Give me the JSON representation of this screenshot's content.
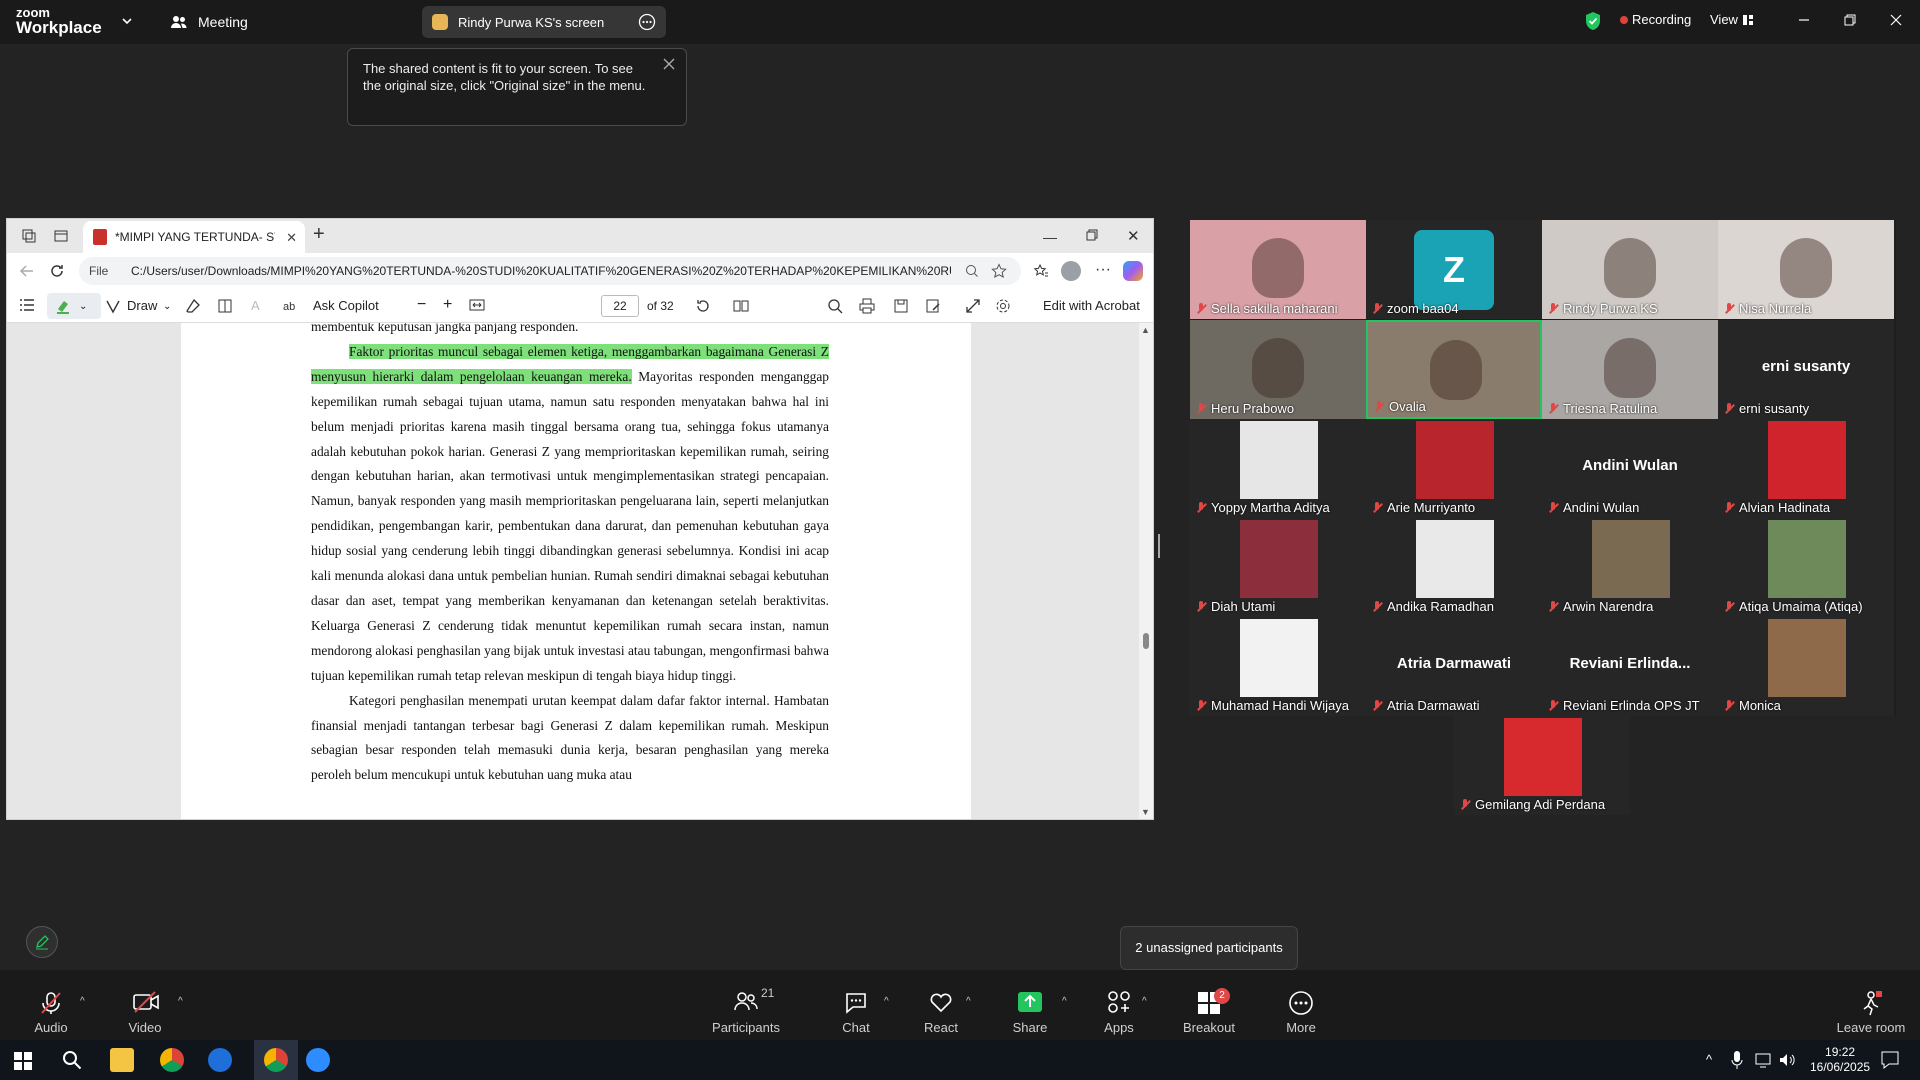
{
  "topbar": {
    "brand_line1": "zoom",
    "brand_line2": "Workplace",
    "meeting_label": "Meeting",
    "share_pill_label": "Rindy Purwa KS's screen",
    "recording_label": "Recording",
    "view_label": "View"
  },
  "tooltip": {
    "text": "The shared content is fit to your screen. To see the original size, click \"Original size\" in the menu."
  },
  "browser": {
    "tab_title": "*MIMPI YANG TERTUNDA- STUDI",
    "file_label": "File",
    "url": "C:/Users/user/Downloads/MIMPI%20YANG%20TERTUNDA-%20STUDI%20KUALITATIF%20GENERASI%20Z%20TERHADAP%20KEPEMILIKAN%20RU...",
    "draw_label": "Draw",
    "ask_copilot_label": "Ask Copilot",
    "page_current": "22",
    "page_total": "of 32",
    "edit_acrobat_label": "Edit with Acrobat"
  },
  "document": {
    "line0": "membentuk keputusan jangka panjang responden.",
    "p1_highlight": "Faktor prioritas muncul sebagai elemen ketiga, menggambarkan bagaimana Generasi Z menyusun hierarki dalam pengelolaan keuangan mereka.",
    "p1_rest": " Mayoritas responden menganggap kepemilikan rumah sebagai tujuan utama, namun satu responden menyatakan bahwa hal ini belum menjadi prioritas karena masih tinggal bersama orang tua, sehingga fokus utamanya adalah kebutuhan pokok harian. Generasi Z yang memprioritaskan kepemilikan rumah, seiring dengan kebutuhan harian, akan termotivasi untuk mengimplementasikan strategi pencapaian. Namun, banyak responden yang masih memprioritaskan pengeluarana lain, seperti melanjutkan pendidikan, pengembangan karir, pembentukan dana darurat, dan pemenuhan kebutuhan gaya hidup sosial yang cenderung lebih tinggi dibandingkan generasi sebelumnya. Kondisi ini acap kali menunda alokasi dana untuk pembelian hunian. Rumah sendiri dimaknai sebagai kebutuhan dasar dan aset, tempat yang memberikan kenyamanan dan ketenangan setelah beraktivitas. Keluarga Generasi Z cenderung tidak menuntut kepemilikan rumah secara instan, namun mendorong alokasi penghasilan yang bijak untuk investasi atau tabungan, mengonfirmasi bahwa tujuan kepemilikan rumah tetap relevan meskipun di tengah biaya hidup tinggi.",
    "p2": "Kategori penghasilan menempati urutan keempat dalam dafar faktor internal. Hambatan finansial menjadi tantangan terbesar bagi Generasi Z dalam kepemilikan rumah. Meskipun sebagian besar responden telah memasuki dunia kerja, besaran penghasilan yang mereka peroleh belum mencukupi untuk kebutuhan uang muka atau"
  },
  "participants": [
    {
      "name": "Sella sakilla maharani",
      "type": "photo",
      "bg": "#d9a0a6"
    },
    {
      "name": "zoom baa04",
      "type": "avatar",
      "letter": "Z",
      "bg": "#1aa3b5"
    },
    {
      "name": "Rindy Purwa KS",
      "type": "photo",
      "bg": "#cfcac6"
    },
    {
      "name": "Nisa Nurrela",
      "type": "photo",
      "bg": "#dcd6d2"
    },
    {
      "name": "Heru Prabowo",
      "type": "photo",
      "bg": "#6e6a62"
    },
    {
      "name": "Ovalia",
      "type": "photo",
      "bg": "#8a7c6c"
    },
    {
      "name": "Triesna Ratulina",
      "type": "photo",
      "bg": "#a9a6a4"
    },
    {
      "name": "erni susanty",
      "type": "text",
      "big": "erni susanty"
    },
    {
      "name": "Yoppy Martha Aditya",
      "type": "small",
      "bg": "#e6e6e6"
    },
    {
      "name": "Arie Murriyanto",
      "type": "small",
      "bg": "#b8252d"
    },
    {
      "name": "Andini Wulan",
      "type": "text",
      "big": "Andini Wulan"
    },
    {
      "name": "Alvian Hadinata",
      "type": "small",
      "bg": "#d0242c"
    },
    {
      "name": "Diah Utami",
      "type": "small",
      "bg": "#8c2e3b"
    },
    {
      "name": "Andika Ramadhan",
      "type": "small",
      "bg": "#e9e9e9"
    },
    {
      "name": "Arwin Narendra",
      "type": "small",
      "bg": "#7a6a52"
    },
    {
      "name": "Atiqa Umaima (Atiqa)",
      "type": "small",
      "bg": "#6f8a5a"
    },
    {
      "name": "Muhamad Handi Wijaya",
      "type": "small",
      "bg": "#f2f2f2"
    },
    {
      "name": "Atria Darmawati",
      "type": "text",
      "big": "Atria Darmawati"
    },
    {
      "name": "Reviani Erlinda OPS JT",
      "type": "text",
      "big": "Reviani  Erlinda..."
    },
    {
      "name": "Monica",
      "type": "small",
      "bg": "#8e6a4a"
    },
    {
      "name": "Gemilang Adi Perdana",
      "type": "small",
      "bg": "#d62a2f"
    }
  ],
  "bottombar": {
    "audio": "Audio",
    "video": "Video",
    "participants": "Participants",
    "participants_count": "21",
    "chat": "Chat",
    "react": "React",
    "share": "Share",
    "apps": "Apps",
    "breakout": "Breakout rooms",
    "breakout_badge": "2",
    "more": "More",
    "leave": "Leave room",
    "unassigned": "2 unassigned participants"
  },
  "taskbar": {
    "time": "19:22",
    "date": "16/06/2025"
  },
  "colors": {
    "highlight": "#7ee07a",
    "share_green": "#22c55e",
    "record_red": "#e0413a"
  }
}
